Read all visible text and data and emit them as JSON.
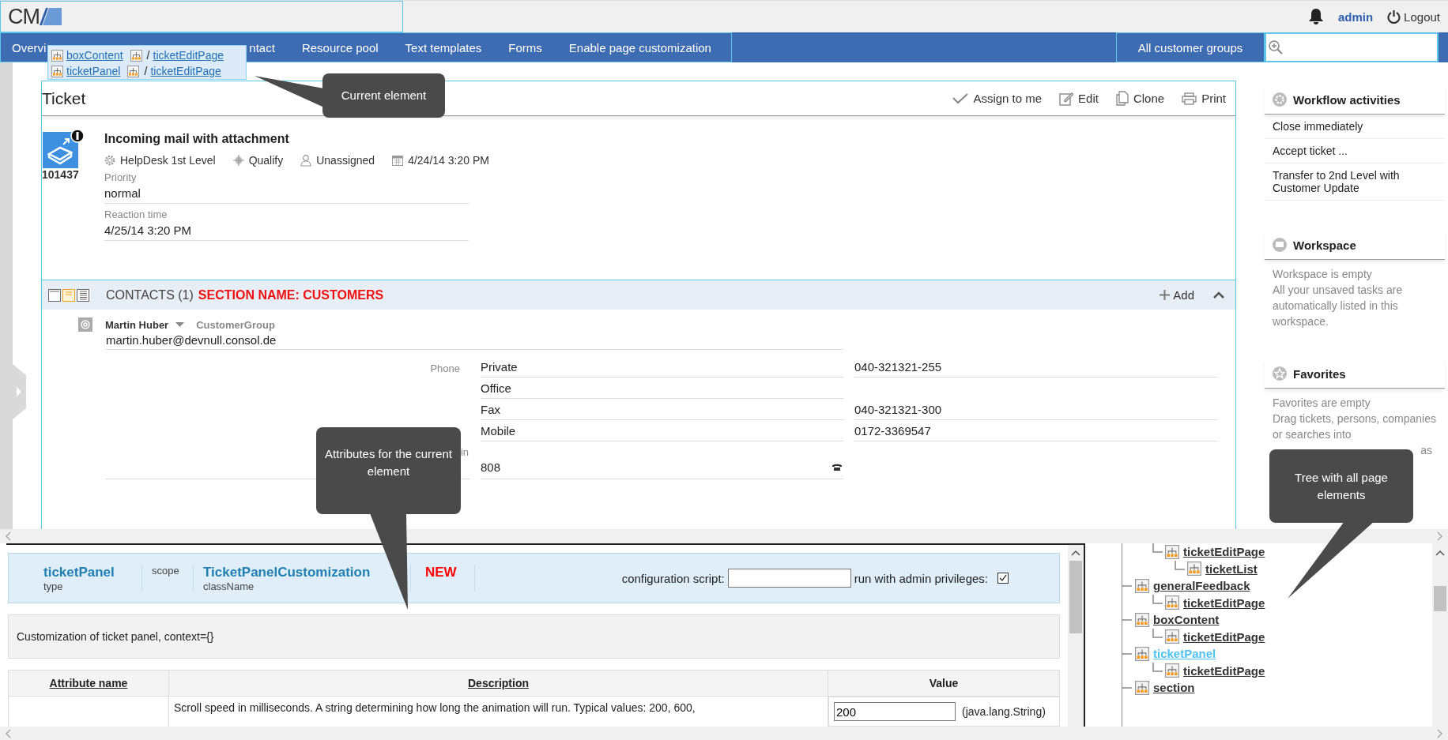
{
  "header": {
    "logo": "CM",
    "user": "admin",
    "logout": "Logout"
  },
  "nav": {
    "items": [
      {
        "label": "Overvi"
      },
      {
        "label": "ntact"
      },
      {
        "label": "Resource pool"
      },
      {
        "label": "Text templates"
      },
      {
        "label": "Forms"
      },
      {
        "label": "Enable page customization"
      }
    ],
    "customer_groups": "All customer groups"
  },
  "breadcrumb": [
    {
      "element": "boxContent",
      "separator": "/",
      "parent": "ticketEditPage"
    },
    {
      "element": "ticketPanel",
      "separator": "/",
      "parent": "ticketEditPage"
    }
  ],
  "callouts": [
    "Current element",
    "Attributes for the current element",
    "Tree with all page elements"
  ],
  "ticket": {
    "title": "Ticket",
    "actions": [
      "Assign to me",
      "Edit",
      "Clone",
      "Print"
    ],
    "number": "101437",
    "subject": "Incoming mail with attachment",
    "queue": "HelpDesk 1st Level",
    "status": "Qualify",
    "assignee": "Unassigned",
    "date": "4/24/14 3:20 PM",
    "fields": [
      {
        "label": "Priority",
        "value": "normal"
      },
      {
        "label": "Reaction time",
        "value": "4/25/14 3:20 PM"
      }
    ]
  },
  "contacts": {
    "title": "CONTACTS (1)",
    "section_name": "SECTION NAME: CUSTOMERS",
    "add": "Add",
    "views": [
      {
        "selected": false
      },
      {
        "selected": true
      },
      {
        "selected": false
      }
    ],
    "contact": {
      "name": "Martin Huber",
      "group": "CustomerGroup",
      "email": "martin.huber@devnull.consol.de",
      "phone_label": "Phone",
      "phones": [
        {
          "type": "Private",
          "number": "040-321321-255"
        },
        {
          "type": "Office"
        },
        {
          "type": "Fax",
          "number": "040-321321-300"
        },
        {
          "type": "Mobile",
          "number": "0172-3369547"
        }
      ],
      "extension_label": "in",
      "extension": "808"
    }
  },
  "sidebar": [
    {
      "kind": "workflow",
      "title": "Workflow activities",
      "items": [
        "Close immediately",
        "Accept ticket ...",
        "Transfer to 2nd Level with Customer Update"
      ]
    },
    {
      "kind": "workspace",
      "title": "Workspace",
      "lines": [
        "Workspace is empty",
        "All your unsaved tasks are automatically listed in this workspace."
      ]
    },
    {
      "kind": "favorites",
      "title": "Favorites",
      "lines": [
        "Favorites are empty",
        "Drag tickets, persons, companies or searches into"
      ],
      "tail": "as"
    }
  ],
  "editor": {
    "type": "ticketPanel",
    "type_label": "type",
    "scope_label": "scope",
    "class_name": "TicketPanelCustomization",
    "class_label": "className",
    "badge": "NEW",
    "script_label": "configuration script:",
    "admin_label": "run with admin privileges:",
    "admin_checked": true,
    "description": "Customization of ticket panel, context={}",
    "columns": [
      "Attribute name",
      "Description",
      "Value"
    ],
    "rows": [
      {
        "description": "Scroll speed in milliseconds. A string determining how long the animation will run. Typical values: 200, 600,",
        "value": "200",
        "value_type": "(java.lang.String)"
      }
    ]
  },
  "tree": {
    "items": [
      {
        "children": [
          {
            "label": "ticketEditPage",
            "selected": false,
            "children": [
              {
                "label": "ticketList",
                "selected": false
              }
            ]
          }
        ]
      },
      {
        "label": "generalFeedback",
        "selected": false,
        "children": [
          {
            "label": "ticketEditPage",
            "selected": false
          }
        ]
      },
      {
        "label": "boxContent",
        "selected": false,
        "children": [
          {
            "label": "ticketEditPage",
            "selected": false
          }
        ]
      },
      {
        "label": "ticketPanel",
        "selected": true,
        "children": [
          {
            "label": "ticketEditPage",
            "selected": false
          }
        ]
      },
      {
        "label": "section",
        "selected": false
      }
    ]
  }
}
